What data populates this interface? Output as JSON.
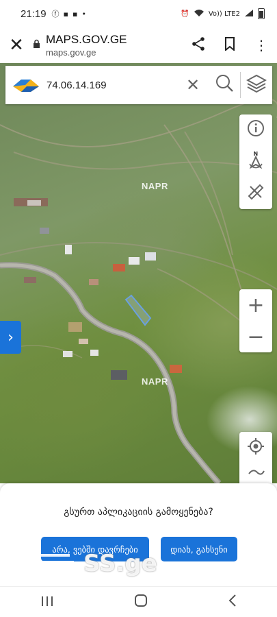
{
  "status_bar": {
    "time": "21:19",
    "notifications": [
      "facebook-icon",
      "message-icon",
      "message-icon",
      "dot"
    ],
    "right_icons": [
      "alarm-icon",
      "wifi-icon",
      "volte-icon",
      "signal-icon",
      "battery-icon"
    ],
    "lte_text": "Vo)) LTE2"
  },
  "browser": {
    "title": "MAPS.GOV.GE",
    "url": "maps.gov.ge"
  },
  "search": {
    "query": "74.06.14.169"
  },
  "map": {
    "watermark_labels": [
      "NAPR",
      "NAPR"
    ],
    "parcel_outline_color": "#6aa0e0"
  },
  "sheet": {
    "question": "გსურთ აპლიკაციის გამოყენება?",
    "stay_button": "არა, ვებში დავრჩები",
    "open_button": "დიახ, გახსენი"
  },
  "watermark": {
    "text": "SS.ge"
  },
  "colors": {
    "accent": "#1a73d9"
  }
}
